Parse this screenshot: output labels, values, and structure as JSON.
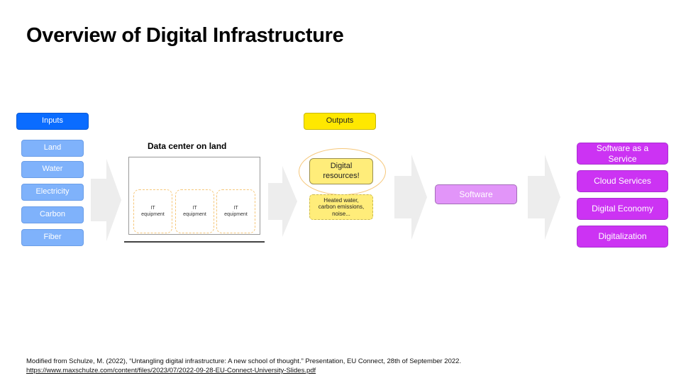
{
  "slide": {
    "title": "Overview of Digital Infrastructure"
  },
  "inputs": {
    "header": "Inputs",
    "items": [
      "Land",
      "Water",
      "Electricity",
      "Carbon",
      "Fiber"
    ]
  },
  "data_center": {
    "title": "Data center on land",
    "equipment": [
      "IT\nequipment",
      "IT\nequipment",
      "IT\nequipment"
    ]
  },
  "outputs": {
    "header": "Outputs",
    "primary": "Digital\nresources!",
    "byproducts": "Heated water,\ncarbon emissions,\nnoise..."
  },
  "software": {
    "label": "Software"
  },
  "results": {
    "items": [
      "Software as a\nService",
      "Cloud Services",
      "Digital Economy",
      "Digitalization"
    ]
  },
  "footer": {
    "citation": "Modified from Schulze, M. (2022), “Untangling digital infrastructure: A new school of thought.” Presentation, EU Connect, 28th of September 2022.",
    "link": "https://www.maxschulze.com/content/files/2023/07/2022-09-28-EU-Connect-University-Slides.pdf"
  },
  "colors": {
    "inputs_header": "#0a6cff",
    "input_item": "#7fb2fb",
    "outputs": "#ffe800",
    "software": "#e295f9",
    "results": "#cc33f3",
    "arrow": "#ededed"
  }
}
